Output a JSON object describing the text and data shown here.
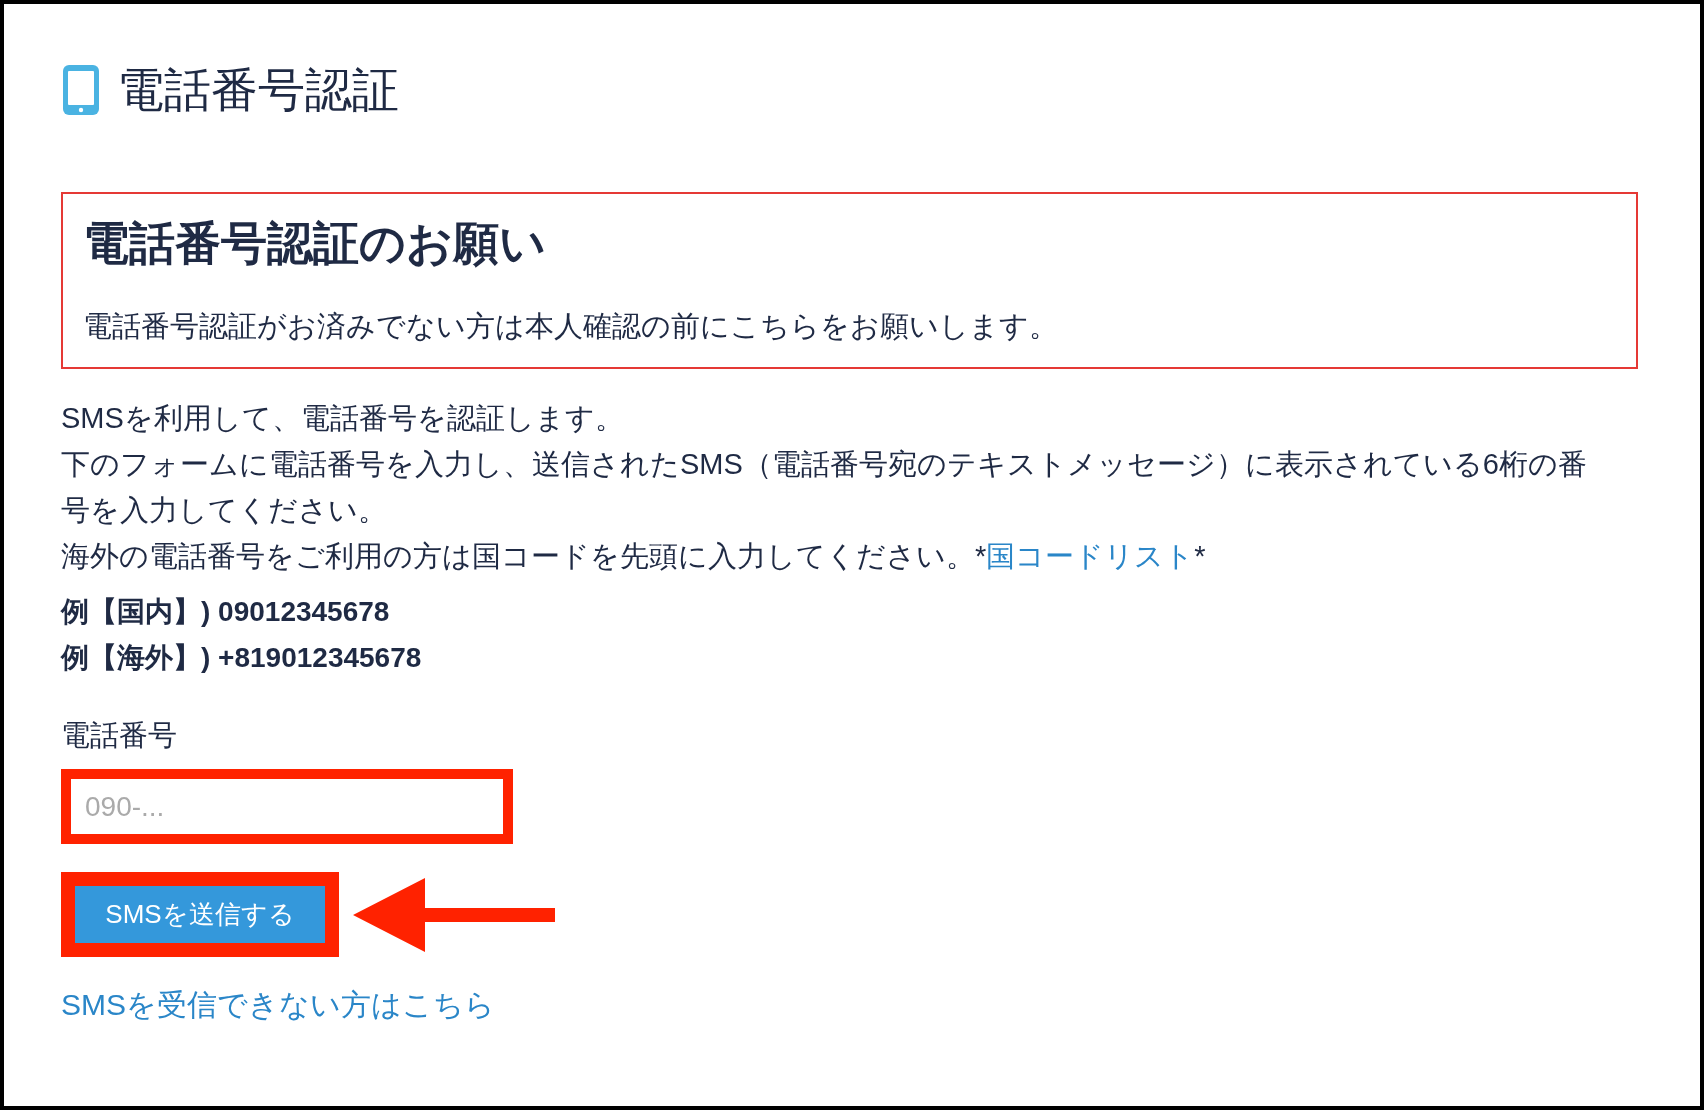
{
  "page_title": "電話番号認証",
  "notice": {
    "heading": "電話番号認証のお願い",
    "body": "電話番号認証がお済みでない方は本人確認の前にこちらをお願いします。"
  },
  "intro_lines": [
    {
      "text": "SMSを利用して、電話番号を認証します。"
    },
    {
      "text": "下のフォームに電話番号を入力し、送信されたSMS（電話番号宛のテキストメッセージ）に表示されている6桁の番号を入力してください。"
    },
    {
      "text": "海外の電話番号をご利用の方は国コードを先頭に入力してください。*",
      "link": "国コードリスト",
      "suffix": "*"
    }
  ],
  "examples": [
    "例【国内】) 09012345678",
    "例【海外】) +819012345678"
  ],
  "phone_field": {
    "label": "電話番号",
    "placeholder": "090-...",
    "highlighted": true
  },
  "send_button": {
    "label": "SMSを送信する",
    "highlighted": true,
    "pointed_at": true
  },
  "help_link": "SMSを受信できない方はこちら"
}
